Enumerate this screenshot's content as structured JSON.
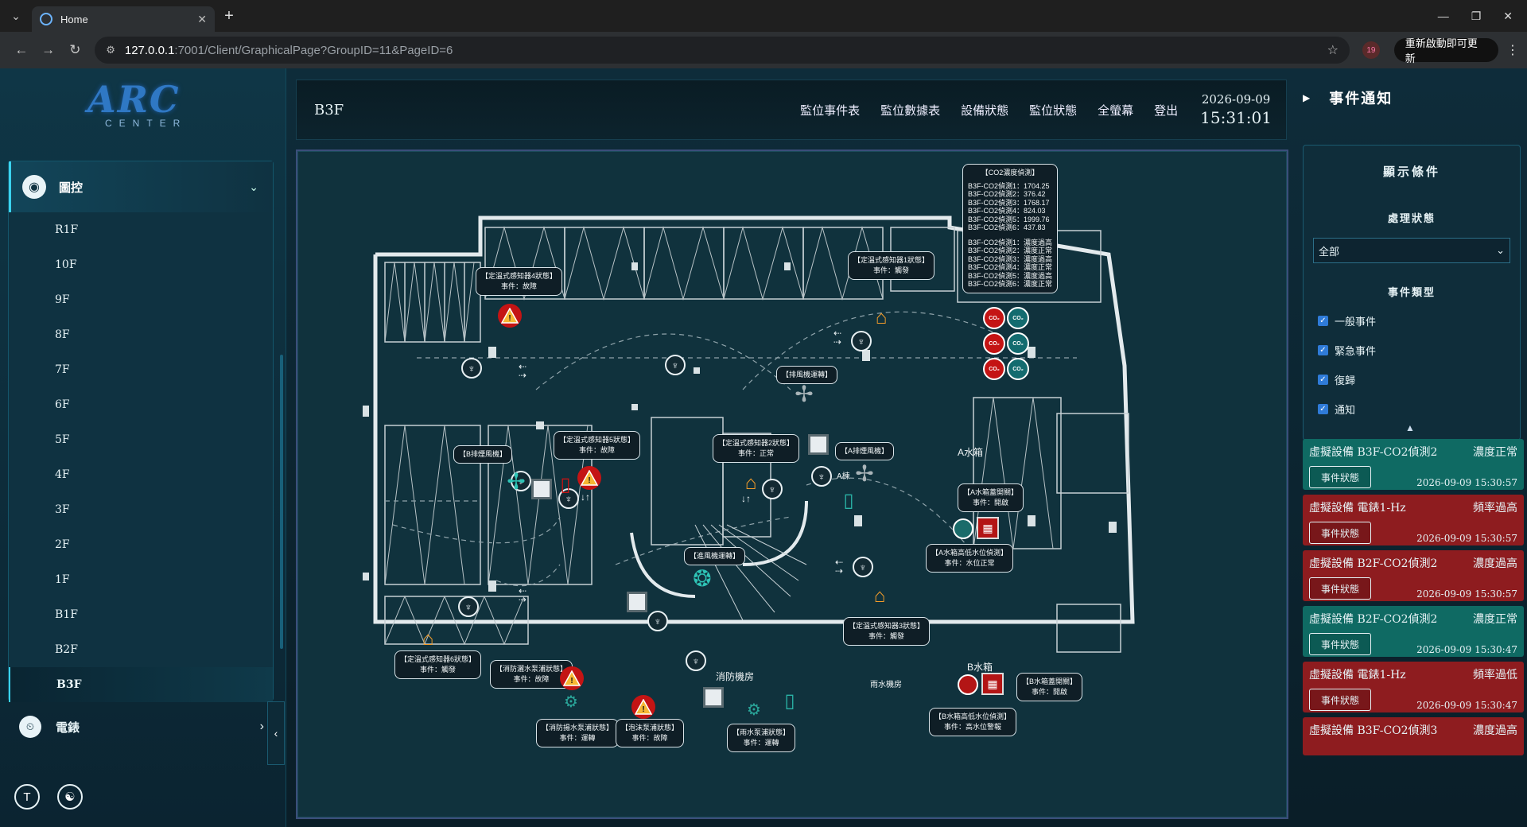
{
  "browser": {
    "tab_title": "Home",
    "url_host": "127.0.0.1",
    "url_path": ":7001/Client/GraphicalPage?GroupID=11&PageID=6",
    "update_button": "重新啟動即可更新",
    "ext_badge": "19"
  },
  "sidebar": {
    "logo_main": "ARC",
    "logo_sub": "CENTER",
    "nav_title": "圖控",
    "floors": [
      "R1F",
      "10F",
      "9F",
      "8F",
      "7F",
      "6F",
      "5F",
      "4F",
      "3F",
      "2F",
      "1F",
      "B1F",
      "B2F",
      "B3F"
    ],
    "active_floor": "B3F",
    "meter_label": "電錶",
    "foot_icon_t": "T"
  },
  "topbar": {
    "floor_title": "B3F",
    "links": [
      "監位事件表",
      "監位數據表",
      "設備狀態",
      "監位狀態",
      "全螢幕",
      "登出"
    ],
    "date": "2026-09-09",
    "time": "15:31:01"
  },
  "map": {
    "labels": {
      "s4": [
        "【定溫式感知器4狀態】",
        "事件：故障"
      ],
      "s1": [
        "【定溫式感知器1狀態】",
        "事件：觸發"
      ],
      "exhaust": [
        "【排風機運轉】"
      ],
      "b_exhaust": [
        "【B排煙風機】"
      ],
      "s5": [
        "【定溫式感知器5狀態】",
        "事件：故障"
      ],
      "s2": [
        "【定溫式感知器2狀態】",
        "事件：正常"
      ],
      "a_smoke": [
        "【A排煙風機】"
      ],
      "a_valve": [
        "【A水箱蓋開關】",
        "事件：開啟"
      ],
      "supply": [
        "【進風機運轉】"
      ],
      "a_level": [
        "【A水箱高低水位偵測】",
        "事件：水位正常"
      ],
      "s3": [
        "【定溫式感知器3狀態】",
        "事件：觸發"
      ],
      "s6": [
        "【定溫式感知器6狀態】",
        "事件：觸發"
      ],
      "fire_pump": [
        "【消防灑水泵浦狀態】",
        "事件：故障"
      ],
      "fire_pump2": [
        "【消防揚水泵浦狀態】",
        "事件：運轉"
      ],
      "foam_pump": [
        "【泡沫泵浦狀態】",
        "事件：故障"
      ],
      "rain_pump": [
        "【雨水泵浦狀態】",
        "事件：運轉"
      ],
      "b_level": [
        "【B水箱高低水位偵測】",
        "事件：高水位警報"
      ],
      "b_valve": [
        "【B水箱蓋開關】",
        "事件：開啟"
      ]
    },
    "texts": {
      "a_tank": "A水箱",
      "a_building": "A棟",
      "fire_room": "消防機房",
      "rain_tank": "雨水機房",
      "b_tank": "B水箱"
    },
    "co2": {
      "title": "【CO2濃度偵測】",
      "values": [
        "B3F-CO2偵測1：1704.25",
        "B3F-CO2偵測2：376.42",
        "B3F-CO2偵測3：1768.17",
        "B3F-CO2偵測4：824.03",
        "B3F-CO2偵測5：1999.76",
        "B3F-CO2偵測6：437.83"
      ],
      "states": [
        "B3F-CO2偵測1：濃度過高",
        "B3F-CO2偵測2：濃度正常",
        "B3F-CO2偵測3：濃度過高",
        "B3F-CO2偵測4：濃度正常",
        "B3F-CO2偵測5：濃度過高",
        "B3F-CO2偵測6：濃度正常"
      ]
    },
    "co2_icon_text": "CO₂"
  },
  "notifications": {
    "header": "事件通知",
    "cond_title": "顯示條件",
    "status_label": "處理狀態",
    "status_value": "全部",
    "type_label": "事件類型",
    "types": [
      "一般事件",
      "緊急事件",
      "復歸",
      "通知"
    ],
    "btn_label": "事件狀態",
    "events": [
      {
        "title": "虛擬設備 B3F-CO2偵測2",
        "state": "濃度正常",
        "time": "2026-09-09 15:30:57",
        "color": "green"
      },
      {
        "title": "虛擬設備 電錶1-Hz",
        "state": "頻率過高",
        "time": "2026-09-09 15:30:57",
        "color": "red"
      },
      {
        "title": "虛擬設備 B2F-CO2偵測2",
        "state": "濃度過高",
        "time": "2026-09-09 15:30:57",
        "color": "red"
      },
      {
        "title": "虛擬設備 B2F-CO2偵測2",
        "state": "濃度正常",
        "time": "2026-09-09 15:30:47",
        "color": "green"
      },
      {
        "title": "虛擬設備 電錶1-Hz",
        "state": "頻率過低",
        "time": "2026-09-09 15:30:47",
        "color": "red"
      },
      {
        "title": "虛擬設備 B3F-CO2偵測3",
        "state": "濃度過高",
        "time": "",
        "color": "red"
      }
    ]
  },
  "colors": {
    "accent": "#3ad3ef",
    "alarm": "#c41414",
    "normal": "#0f6a63",
    "house": "#f39c2a"
  }
}
